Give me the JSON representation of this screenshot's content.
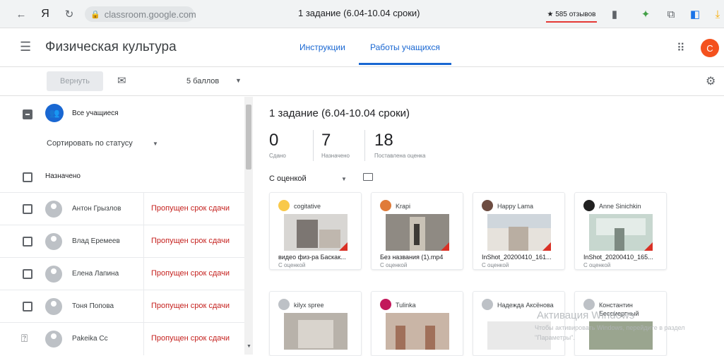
{
  "browser": {
    "url": "classroom.google.com",
    "tab_title": "1 задание (6.04-10.04 сроки)",
    "reviews_badge": "★ 585 отзывов",
    "ya_logo": "Я"
  },
  "app": {
    "class_name": "Физическая культура",
    "tabs": [
      {
        "label": "Инструкции"
      },
      {
        "label": "Работы учащихся"
      }
    ],
    "avatar_letter": "C"
  },
  "toolbar": {
    "return_label": "Вернуть",
    "points_label": "5 баллов"
  },
  "left_panel": {
    "all_students": "Все учащиеся",
    "sort_label": "Сортировать по статусу",
    "assigned_header": "Назначено",
    "students": [
      {
        "name": "Антон Грызлов",
        "status": "Пропущен срок сдачи"
      },
      {
        "name": "Влад Еремеев",
        "status": "Пропущен срок сдачи"
      },
      {
        "name": "Елена Лапина",
        "status": "Пропущен срок сдачи"
      },
      {
        "name": "Тоня Попова",
        "status": "Пропущен срок сдачи"
      },
      {
        "name": "Pakeika Cc",
        "status": "Пропущен срок сдачи"
      }
    ]
  },
  "assignment": {
    "title": "1 задание (6.04-10.04 сроки)",
    "stats": [
      {
        "value": "0",
        "label": "Сдано"
      },
      {
        "value": "7",
        "label": "Назначено"
      },
      {
        "value": "18",
        "label": "Поставлена оценка"
      }
    ],
    "filter_label": "С оценкой"
  },
  "cards": [
    {
      "user": "cogitative",
      "file": "видео физ-ра Баскак...",
      "grade": "С оценкой"
    },
    {
      "user": "Krapi",
      "file": "Без названия (1).mp4",
      "grade": "С оценкой"
    },
    {
      "user": "Happy Lama",
      "file": "InShot_20200410_161...",
      "grade": "С оценкой"
    },
    {
      "user": "Anne Sinichkin",
      "file": "InShot_20200410_165...",
      "grade": "С оценкой"
    },
    {
      "user": "kilyx spree"
    },
    {
      "user": "Tulinka"
    },
    {
      "user": "Надежда Аксёнова"
    },
    {
      "user": "Константин Бессмертный"
    }
  ],
  "watermark": {
    "title": "Активация Windows",
    "text": "Чтобы активировать Windows, перейдите в раздел \"Параметры\"."
  },
  "colors": {
    "accent": "#1967d2",
    "late": "#c5221f",
    "avatar": "#f4511e"
  }
}
